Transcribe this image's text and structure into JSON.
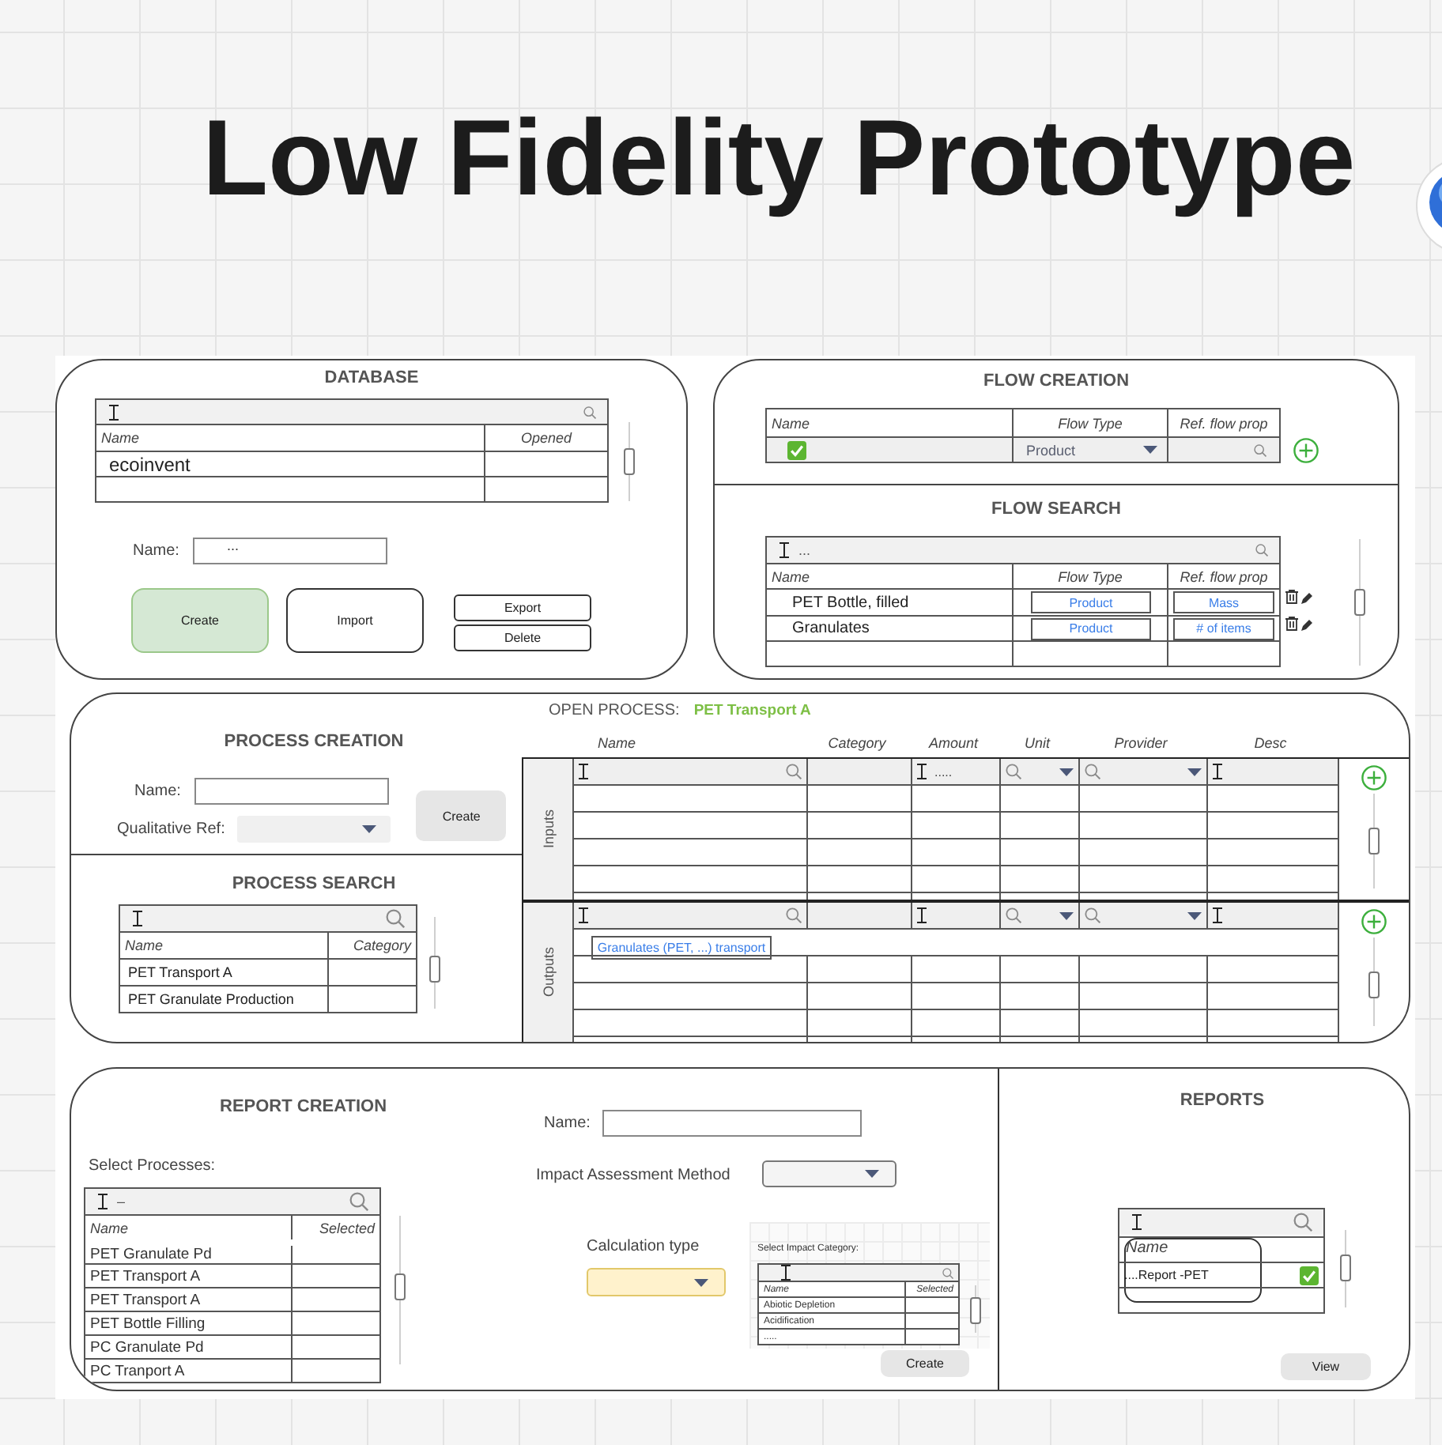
{
  "title": "Low Fidelity Prototype",
  "database": {
    "title": "DATABASE",
    "columns": [
      "Name",
      "Opened"
    ],
    "rows": [
      {
        "name": "ecoinvent"
      }
    ],
    "name_field": {
      "label": "Name:",
      "value": "..."
    },
    "buttons": [
      {
        "label": "Create",
        "kind": "primary"
      },
      {
        "label": "Import",
        "kind": "outline"
      },
      {
        "label": "Export",
        "kind": "small"
      },
      {
        "label": "Delete",
        "kind": "small"
      }
    ]
  },
  "flow_creation": {
    "title": "FLOW CREATION",
    "columns": [
      "Name",
      "Flow Type",
      "Ref. flow prop"
    ],
    "new_row": {
      "checked": true,
      "flow_type": "Product"
    }
  },
  "flow_search": {
    "title": "FLOW SEARCH",
    "search_value": "...",
    "columns": [
      "Name",
      "Flow Type",
      "Ref. flow prop"
    ],
    "rows": [
      {
        "name": "PET Bottle, filled",
        "flow_type": "Product",
        "ref_flow_prop": "Mass"
      },
      {
        "name": "Granulates",
        "flow_type": "Product",
        "ref_flow_prop": "# of items"
      }
    ]
  },
  "process_creation": {
    "title": "PROCESS CREATION",
    "name_label": "Name:",
    "ref_label": "Qualitative Ref:",
    "button": "Create"
  },
  "process_search": {
    "title": "PROCESS SEARCH",
    "columns": [
      "Name",
      "Category"
    ],
    "rows": [
      {
        "name": "PET Transport A"
      },
      {
        "name": "PET Granulate Production"
      }
    ]
  },
  "open_process": {
    "label": "OPEN PROCESS:",
    "value": "PET Transport A",
    "columns": [
      "Name",
      "Category",
      "Amount",
      "Unit",
      "Provider",
      "Desc"
    ],
    "sections": [
      {
        "label": "Inputs",
        "amount_filter": "....."
      },
      {
        "label": "Outputs",
        "rows": [
          {
            "name": "Granulates (PET, ...) transport"
          }
        ]
      }
    ]
  },
  "report_creation": {
    "title": "REPORT CREATION",
    "select_label": "Select Processes:",
    "search_value": "–",
    "columns": [
      "Name",
      "Selected"
    ],
    "rows": [
      {
        "name": "PET Granulate Pd"
      },
      {
        "name": "PET Transport A"
      },
      {
        "name": "PET Transport A"
      },
      {
        "name": "PET Bottle Filling"
      },
      {
        "name": "PC Granulate Pd"
      },
      {
        "name": "PC Tranport A"
      }
    ],
    "name_label": "Name:",
    "method_label": "Impact Assessment Method",
    "calc_label": "Calculation type",
    "impact_category": {
      "label": "Select Impact Category:",
      "columns": [
        "Name",
        "Selected"
      ],
      "rows": [
        {
          "name": "Abiotic Depletion"
        },
        {
          "name": "Acidification"
        },
        {
          "name": "....."
        }
      ]
    },
    "button": "Create"
  },
  "reports": {
    "title": "REPORTS",
    "columns": [
      "Name"
    ],
    "rows": [
      {
        "name": "....Report -PET",
        "checked": true
      }
    ],
    "button": "View"
  }
}
